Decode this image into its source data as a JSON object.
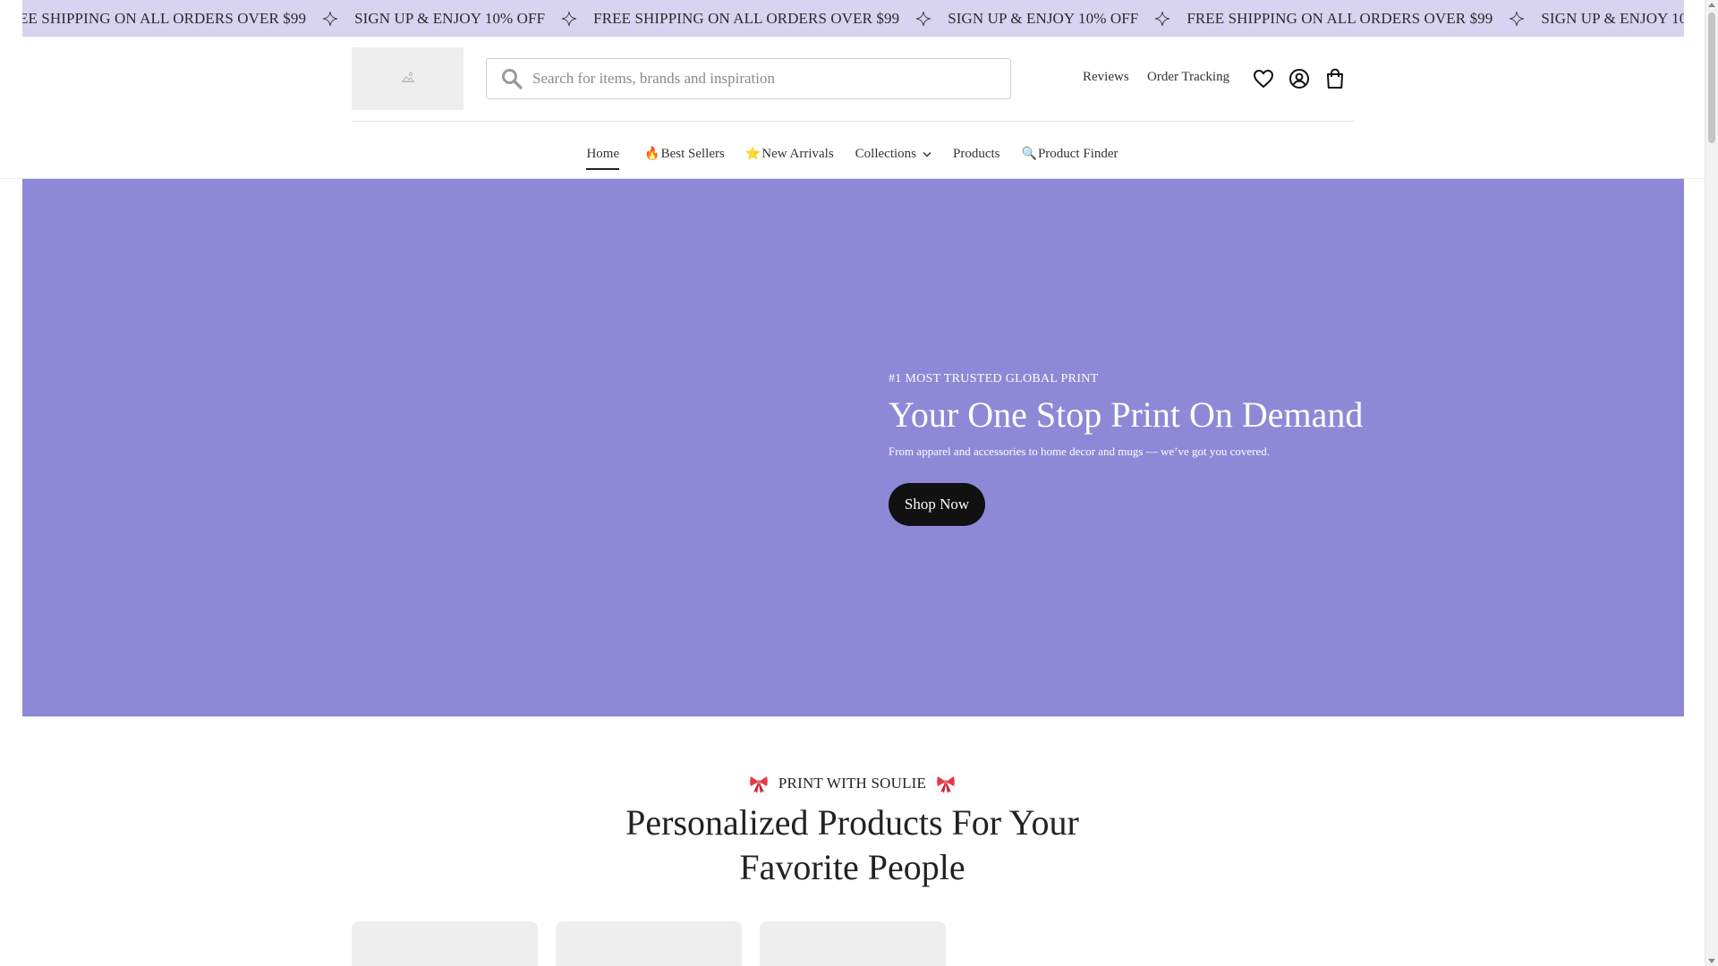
{
  "announcement": {
    "messages": [
      "FREE SHIPPING ON ALL ORDERS OVER $99",
      "SIGN UP & ENJOY 10% OFF",
      "FREE SHIPPING ON ALL ORDERS OVER $99",
      "SIGN UP & ENJOY 10% OFF",
      "FREE SHIPPING ON ALL ORDERS OVER $99",
      "SIGN UP & ENJOY 10% OFF",
      "FREE SHIPPING ON ALL ORDERS OVER $99"
    ],
    "separator_icon": "sparkle-icon",
    "background": "#d8d3f0"
  },
  "header": {
    "logo_icon": "image-placeholder-icon",
    "search": {
      "placeholder": "Search for items, brands and inspiration",
      "value": "",
      "icon": "search-icon"
    },
    "links": {
      "reviews": "Reviews",
      "order_tracking": "Order Tracking"
    },
    "icons": [
      "heart-icon",
      "account-icon",
      "shopping-bag-icon"
    ]
  },
  "nav": {
    "items": [
      {
        "label": "Home",
        "active": true
      },
      {
        "label": "Best Sellers",
        "icon": "🔥"
      },
      {
        "label": "New Arrivals",
        "icon": "⭐"
      },
      {
        "label": "Collections",
        "has_dropdown": true
      },
      {
        "label": "Products"
      },
      {
        "label": "Product Finder",
        "icon": "🔍"
      }
    ]
  },
  "hero": {
    "eyebrow": "#1 MOST TRUSTED GLOBAL PRINT",
    "title": "Your One Stop Print On Demand",
    "subtitle": "From apparel and accessories to home decor and mugs — we’ve got you covered.",
    "cta": "Shop Now",
    "background": "#8e88d7"
  },
  "section": {
    "eyebrow": "PRINT WITH SOULIE",
    "title_line1": "Personalized Products For Your",
    "title_line2": "Favorite People",
    "eyebrow_icon": "ribbon-bow-icon"
  },
  "colors": {
    "accent": "#8e88d7",
    "button": "#111111",
    "announce_bg": "#d8d3f0"
  }
}
